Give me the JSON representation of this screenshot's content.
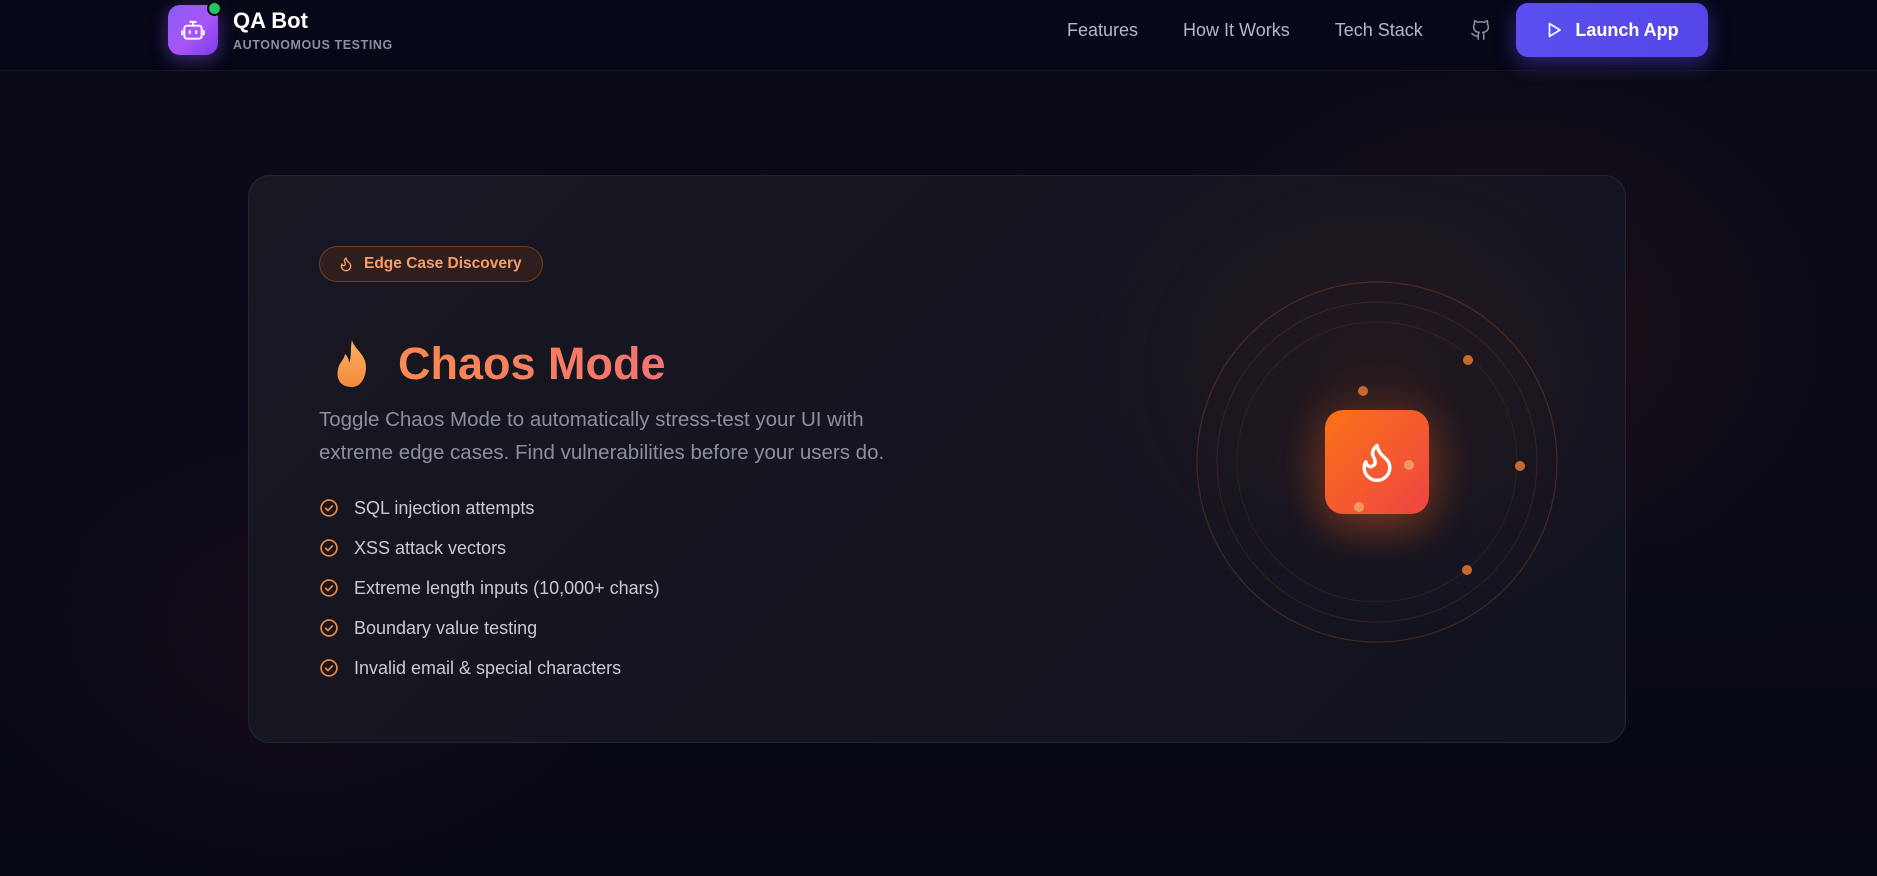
{
  "brand": {
    "name": "QA Bot",
    "tagline": "AUTONOMOUS TESTING",
    "logo_icon": "robot-icon",
    "status_color": "#22c55e"
  },
  "nav": {
    "links": [
      "Features",
      "How It Works",
      "Tech Stack"
    ],
    "github_icon": "github-icon",
    "launch_button": "Launch App",
    "launch_icon": "play-icon"
  },
  "feature_card": {
    "badge": "Edge Case Discovery",
    "badge_icon": "flame-icon",
    "title": "Chaos Mode",
    "title_icon": "fire-emoji-icon",
    "description": "Toggle Chaos Mode to automatically stress-test your UI with extreme edge cases. Find vulnerabilities before your users do.",
    "items": [
      "SQL injection attempts",
      "XSS attack vectors",
      "Extreme length inputs (10,000+ chars)",
      "Boundary value testing",
      "Invalid email & special characters"
    ],
    "item_icon": "check-circle-icon",
    "visual_icon": "flame-icon"
  },
  "colors": {
    "accent_orange": "#f97316",
    "accent_red": "#ef4444",
    "primary_button": "#5b4ff0",
    "logo_purple": "#8b5cf6"
  }
}
